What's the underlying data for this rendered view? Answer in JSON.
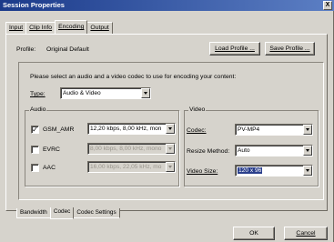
{
  "window": {
    "title": "Session Properties",
    "close_label": "X"
  },
  "tabs": [
    "Input",
    "Clip Info",
    "Encoding",
    "Output"
  ],
  "active_tab": "Encoding",
  "profile": {
    "label": "Profile:",
    "value": "Original Default",
    "load_button": "Load Profile ...",
    "save_button": "Save Profile ..."
  },
  "instructions": "Please select an audio and a video codec to use for encoding your content:",
  "type": {
    "label": "Type:",
    "value": "Audio & Video"
  },
  "audio": {
    "group_label": "Audio",
    "codecs": [
      {
        "name": "GSM_AMR",
        "checked": "✓",
        "value": "12,20 kbps, 8,00 kHz, mon",
        "enabled": true
      },
      {
        "name": "EVRC",
        "checked": "",
        "value": "8,00 kbps, 8,00 kHz, mono",
        "enabled": false
      },
      {
        "name": "AAC",
        "checked": "",
        "value": "16,00 kbps, 22,05 kHz, mo",
        "enabled": false
      }
    ]
  },
  "video": {
    "group_label": "Video",
    "codec_label": "Codec:",
    "codec_value": "PV-MP4",
    "resize_label": "Resize Method:",
    "resize_value": "Auto",
    "size_label": "Video Size:",
    "size_value": "120 x 96"
  },
  "subtabs": [
    "Bandwidth",
    "Codec",
    "Codec Settings"
  ],
  "active_subtab": "Codec",
  "footer": {
    "ok_label": "OK",
    "cancel_label": "Cancel"
  }
}
